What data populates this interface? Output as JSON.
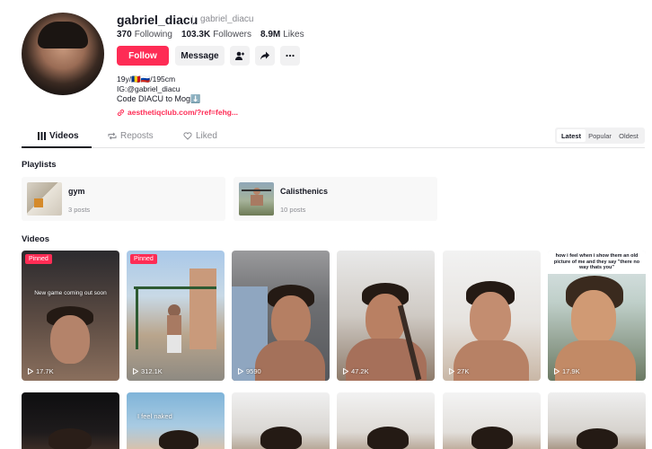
{
  "profile": {
    "username": "gabriel_diacu",
    "nickname": "gabriel_diacu",
    "following_count": "370",
    "following_label": "Following",
    "followers_count": "103.3K",
    "followers_label": "Followers",
    "likes_count": "8.9M",
    "likes_label": "Likes",
    "follow_label": "Follow",
    "message_label": "Message",
    "bio_line1": "19y/🇷🇴🇷🇺/195cm",
    "bio_line2": "IG:@gabriel_diacu",
    "bio_line3": "Code DIACU to Mog⬇️",
    "link": "aesthetiqclub.com/?ref=fehg..."
  },
  "tabs": [
    {
      "label": "Videos",
      "icon": "grid-icon"
    },
    {
      "label": "Reposts",
      "icon": "repost-icon"
    },
    {
      "label": "Liked",
      "icon": "heart-outline-icon"
    }
  ],
  "sort": [
    "Latest",
    "Popular",
    "Oldest"
  ],
  "playlists_title": "Playlists",
  "playlists": [
    {
      "name": "gym",
      "count": "3 posts"
    },
    {
      "name": "Calisthenics",
      "count": "10 posts"
    }
  ],
  "videos_title": "Videos",
  "videos": [
    {
      "views": "17.7K",
      "pinned": "Pinned",
      "overlay": "New game coming out soon"
    },
    {
      "views": "312.1K",
      "pinned": "Pinned"
    },
    {
      "views": "9590"
    },
    {
      "views": "47.2K"
    },
    {
      "views": "27K"
    },
    {
      "views": "17.9K",
      "top_text": "how i feel when i show them an old picture of me and they say \"there no way thats you\""
    }
  ],
  "videos_row2": [
    {
      "overlay": "I feel naked"
    }
  ],
  "colors": {
    "accent": "#fe2c55",
    "text": "#161823",
    "muted": "#8a8b91"
  }
}
